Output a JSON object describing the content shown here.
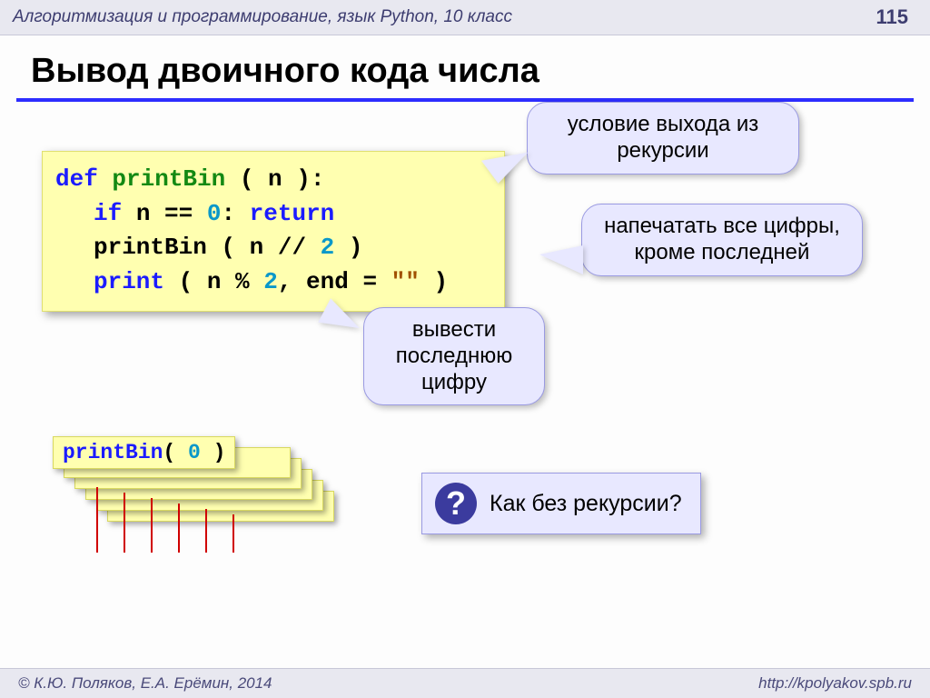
{
  "header": {
    "course": "Алгоритмизация и программирование, язык Python, 10 класс",
    "page": "115"
  },
  "title": "Вывод двоичного кода числа",
  "code": {
    "line1": {
      "def": "def",
      "name": "printBin",
      "sig_open": " ( n ):"
    },
    "line2": {
      "if": "if",
      "cond": " n == ",
      "zero": "0",
      "after": ": ",
      "ret": "return"
    },
    "line3": {
      "call": "printBin",
      "args_open": " ( n // ",
      "two": "2",
      "args_close": " )"
    },
    "line4": {
      "print": "print",
      "open": " ( n % ",
      "two": "2",
      "sep": ", end = ",
      "str": "\"\"",
      "close": " )"
    }
  },
  "callouts": {
    "exit": "условие выхода из рекурсии",
    "all_digits": "напечатать все цифры, кроме последней",
    "last_digit": "вывести последнюю цифру"
  },
  "stack": {
    "top_label": "printBin( 0 )"
  },
  "question": {
    "mark": "?",
    "text": "Как без рекурсии?"
  },
  "footer": {
    "left": "© К.Ю. Поляков, Е.А. Ерёмин, 2014",
    "right": "http://kpolyakov.spb.ru"
  }
}
